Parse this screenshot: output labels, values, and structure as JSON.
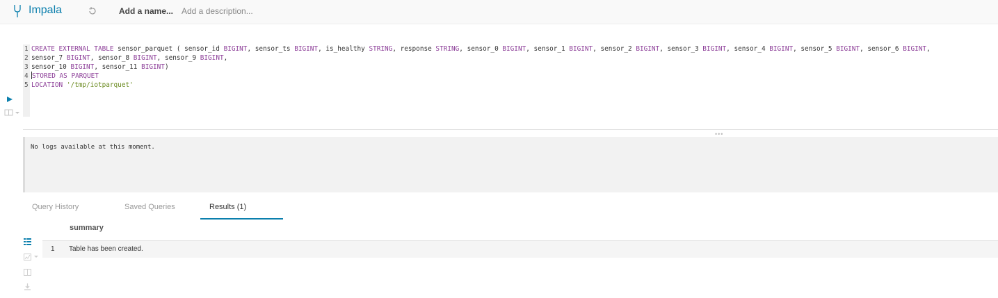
{
  "header": {
    "app_title": "Impala",
    "name_placeholder": "Add a name...",
    "description_placeholder": "Add a description..."
  },
  "editor": {
    "lines": [
      {
        "num": "1",
        "segments": [
          {
            "t": "CREATE EXTERNAL TABLE",
            "k": "kw"
          },
          {
            "t": " sensor_parquet ( sensor_id ",
            "k": ""
          },
          {
            "t": "BIGINT",
            "k": "kw"
          },
          {
            "t": ", sensor_ts ",
            "k": ""
          },
          {
            "t": "BIGINT",
            "k": "kw"
          },
          {
            "t": ", is_healthy ",
            "k": ""
          },
          {
            "t": "STRING",
            "k": "kw"
          },
          {
            "t": ", response ",
            "k": ""
          },
          {
            "t": "STRING",
            "k": "kw"
          },
          {
            "t": ", sensor_0 ",
            "k": ""
          },
          {
            "t": "BIGINT",
            "k": "kw"
          },
          {
            "t": ", sensor_1 ",
            "k": ""
          },
          {
            "t": "BIGINT",
            "k": "kw"
          },
          {
            "t": ", sensor_2 ",
            "k": ""
          },
          {
            "t": "BIGINT",
            "k": "kw"
          },
          {
            "t": ", sensor_3 ",
            "k": ""
          },
          {
            "t": "BIGINT",
            "k": "kw"
          },
          {
            "t": ", sensor_4 ",
            "k": ""
          },
          {
            "t": "BIGINT",
            "k": "kw"
          },
          {
            "t": ", sensor_5 ",
            "k": ""
          },
          {
            "t": "BIGINT",
            "k": "kw"
          },
          {
            "t": ", sensor_6 ",
            "k": ""
          },
          {
            "t": "BIGINT",
            "k": "kw"
          },
          {
            "t": ",",
            "k": ""
          }
        ]
      },
      {
        "num": "2",
        "segments": [
          {
            "t": "sensor_7 ",
            "k": ""
          },
          {
            "t": "BIGINT",
            "k": "kw"
          },
          {
            "t": ", sensor_8 ",
            "k": ""
          },
          {
            "t": "BIGINT",
            "k": "kw"
          },
          {
            "t": ", sensor_9 ",
            "k": ""
          },
          {
            "t": "BIGINT",
            "k": "kw"
          },
          {
            "t": ",",
            "k": ""
          }
        ]
      },
      {
        "num": "3",
        "segments": [
          {
            "t": "sensor_10 ",
            "k": ""
          },
          {
            "t": "BIGINT",
            "k": "kw"
          },
          {
            "t": ", sensor_11 ",
            "k": ""
          },
          {
            "t": "BIGINT",
            "k": "kw"
          },
          {
            "t": ")",
            "k": ""
          }
        ]
      },
      {
        "num": "4",
        "segments": [
          {
            "t": "STORED AS PARQUET",
            "k": "kw"
          }
        ]
      },
      {
        "num": "5",
        "segments": [
          {
            "t": "LOCATION",
            "k": "kw"
          },
          {
            "t": " ",
            "k": ""
          },
          {
            "t": "'/tmp/iotparquet'",
            "k": "str"
          }
        ]
      }
    ]
  },
  "logs": {
    "message": "No logs available at this moment."
  },
  "tabs": [
    {
      "label": "Query History"
    },
    {
      "label": "Saved Queries"
    },
    {
      "label": "Results (1)"
    }
  ],
  "results": {
    "column": "summary",
    "rows": [
      {
        "num": "1",
        "value": "Table has been created."
      }
    ]
  },
  "icons": {
    "logo": "impala-fork-icon",
    "history": "history-icon",
    "run": "play-icon",
    "snippet": "book-icon",
    "grid": "grid-icon",
    "chart": "chart-icon",
    "columns": "columns-icon",
    "download": "download-icon"
  },
  "colors": {
    "accent": "#0b7fad",
    "keyword": "#8b3c97",
    "string": "#6a8a1f"
  }
}
